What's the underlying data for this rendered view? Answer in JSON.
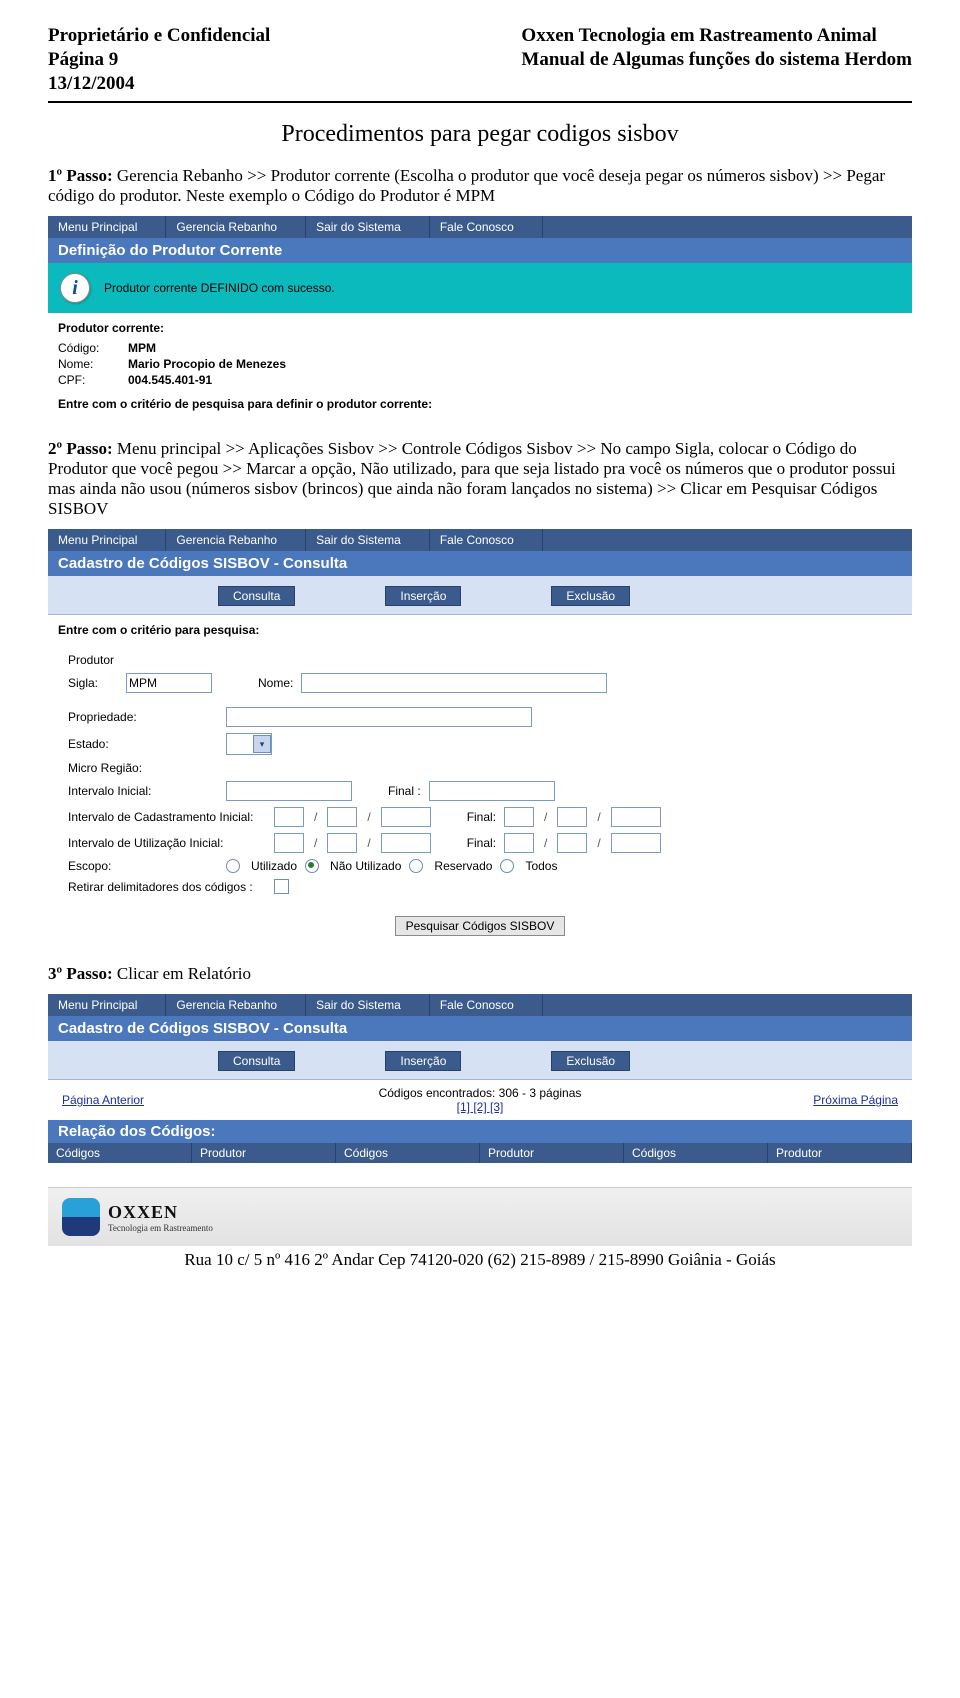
{
  "header": {
    "left1": "Proprietário e Confidencial",
    "left2": "Página 9",
    "left3": "13/12/2004",
    "right1": "Oxxen Tecnologia em Rastreamento Animal",
    "right2": "Manual de Algumas funções do sistema Herdom"
  },
  "title": "Procedimentos para pegar codigos sisbov",
  "passo1_lead": "1º Passo:",
  "passo1_text": " Gerencia Rebanho >> Produtor corrente (Escolha o produtor que você deseja pegar os números sisbov)  >> Pegar código do produtor. Neste exemplo o Código do Produtor é MPM",
  "ui1": {
    "menu": [
      "Menu Principal",
      "Gerencia Rebanho",
      "Sair do Sistema",
      "Fale Conosco"
    ],
    "titlebar": "Definição do Produtor Corrente",
    "cyan_msg": "Produtor corrente DEFINIDO com sucesso.",
    "sec_label": "Produtor corrente:",
    "rows": [
      {
        "k": "Código:",
        "v": "MPM"
      },
      {
        "k": "Nome:",
        "v": "Mario Procopio de Menezes"
      },
      {
        "k": "CPF:",
        "v": "004.545.401-91"
      }
    ],
    "criteria": "Entre com o critério de pesquisa para definir o produtor corrente:"
  },
  "passo2_lead": "2º Passo:",
  "passo2_text": " Menu principal >> Aplicações Sisbov >> Controle Códigos Sisbov >> No campo Sigla, colocar o Código do Produtor que você pegou >> Marcar a opção, Não utilizado, para que seja listado pra você os números que o produtor possui mas ainda não usou (números sisbov (brincos) que ainda não foram lançados no sistema) >> Clicar em Pesquisar Códigos SISBOV",
  "ui2": {
    "menu": [
      "Menu Principal",
      "Gerencia Rebanho",
      "Sair do Sistema",
      "Fale Conosco"
    ],
    "titlebar": "Cadastro de Códigos SISBOV - Consulta",
    "tabs": [
      "Consulta",
      "Inserção",
      "Exclusão"
    ],
    "criteria_head": "Entre com o critério para pesquisa:",
    "labels": {
      "produtor": "Produtor",
      "sigla": "Sigla:",
      "nome": "Nome:",
      "propriedade": "Propriedade:",
      "estado": "Estado:",
      "micro": "Micro Região:",
      "intervalo_inicial": "Intervalo Inicial:",
      "final": "Final :",
      "cad_inicial": "Intervalo de Cadastramento Inicial:",
      "cad_final": "Final:",
      "util_inicial": "Intervalo de Utilização Inicial:",
      "util_final": "Final:",
      "escopo": "Escopo:",
      "retirar": "Retirar delimitadores dos códigos :"
    },
    "sigla_value": "MPM",
    "escopo_opts": [
      "Utilizado",
      "Não Utilizado",
      "Reservado",
      "Todos"
    ],
    "escopo_selected": 1,
    "search_btn": "Pesquisar Códigos SISBOV"
  },
  "passo3_lead": "3º Passo:",
  "passo3_text": " Clicar em Relatório",
  "ui3": {
    "menu": [
      "Menu Principal",
      "Gerencia Rebanho",
      "Sair do Sistema",
      "Fale Conosco"
    ],
    "titlebar": "Cadastro de Códigos SISBOV - Consulta",
    "tabs": [
      "Consulta",
      "Inserção",
      "Exclusão"
    ],
    "pager": {
      "prev": "Página Anterior",
      "mid1": "Códigos encontrados: 306 - 3 páginas",
      "pages": "[1]  [2]  [3]",
      "next": "Próxima Página"
    },
    "rel_title": "Relação dos Códigos:",
    "cols": [
      "Códigos",
      "Produtor",
      "Códigos",
      "Produtor",
      "Códigos",
      "Produtor"
    ]
  },
  "footer": {
    "logo_name": "OXXEN",
    "logo_sub": "Tecnologia em Rastreamento",
    "line": "Rua 10 c/ 5 nº 416 2º Andar Cep 74120-020 (62) 215-8989 / 215-8990 Goiânia - Goiás"
  }
}
